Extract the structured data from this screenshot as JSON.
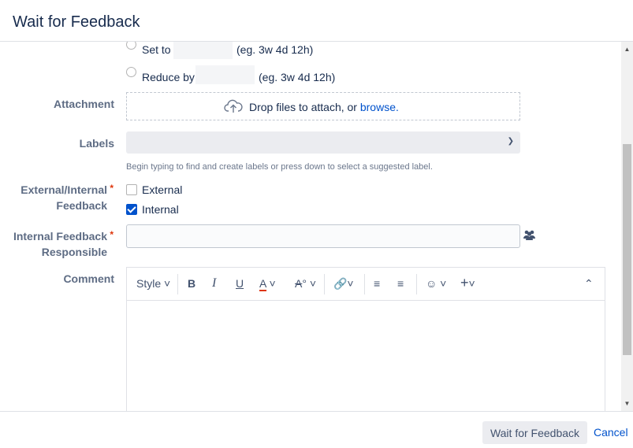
{
  "dialog": {
    "title": "Wait for Feedback"
  },
  "time": {
    "set_to_label": "Set to",
    "set_to_hint": "(eg. 3w 4d 12h)",
    "reduce_by_label": "Reduce by",
    "reduce_by_hint": "(eg. 3w 4d 12h)"
  },
  "attachment": {
    "label": "Attachment",
    "drop_text": "Drop files to attach, or ",
    "browse_link": "browse."
  },
  "labels": {
    "label": "Labels",
    "help": "Begin typing to find and create labels or press down to select a suggested label."
  },
  "ext_int": {
    "label_line1": "External/Internal",
    "label_line2": "Feedback",
    "required": "*",
    "option_external": "External",
    "option_internal": "Internal",
    "external_checked": false,
    "internal_checked": true
  },
  "responsible": {
    "label_line1": "Internal Feedback",
    "label_line2": "Responsible",
    "required": "*"
  },
  "comment": {
    "label": "Comment",
    "style_label": "Style"
  },
  "footer": {
    "submit_label": "Wait for Feedback",
    "cancel_label": "Cancel"
  },
  "colors": {
    "accent": "#0052cc",
    "required": "#de350b",
    "text_color_red": "#de350b"
  }
}
